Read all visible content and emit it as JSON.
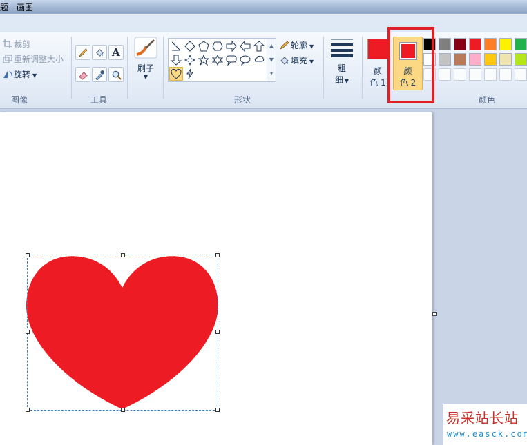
{
  "window": {
    "title": "题 - 画图"
  },
  "ribbon": {
    "image_group": {
      "label": "图像",
      "crop": "裁剪",
      "resize": "重新调整大小",
      "rotate": "旋转"
    },
    "tools_group": {
      "label": "工具"
    },
    "brushes": {
      "label": "刷子"
    },
    "shapes_group": {
      "label": "形状",
      "outline": "轮廓",
      "fill": "填充",
      "selected_shape": "heart"
    },
    "size": {
      "label_line1": "粗",
      "label_line2": "细"
    },
    "colors_group": {
      "label": "颜色",
      "color1": {
        "label_line1": "颜",
        "label_line2": "色 1",
        "value": "#ed1c24"
      },
      "color2": {
        "label_line1": "颜",
        "label_line2": "色 2",
        "value": "#ed1c24"
      },
      "palette_row1": [
        "#000000",
        "#7f7f7f",
        "#880015",
        "#ed1c24",
        "#ff7f27",
        "#fff200",
        "#22b14c"
      ],
      "palette_row2": [
        "#ffffff",
        "#c3c3c3",
        "#b97a57",
        "#ffaec9",
        "#ffc90e",
        "#efe4b0",
        "#b5e61d"
      ]
    }
  },
  "canvas": {
    "heart_color": "#ed1c24",
    "background": "#ffffff"
  },
  "watermark": {
    "title": "易采站长站",
    "url": "www.easck.com"
  }
}
